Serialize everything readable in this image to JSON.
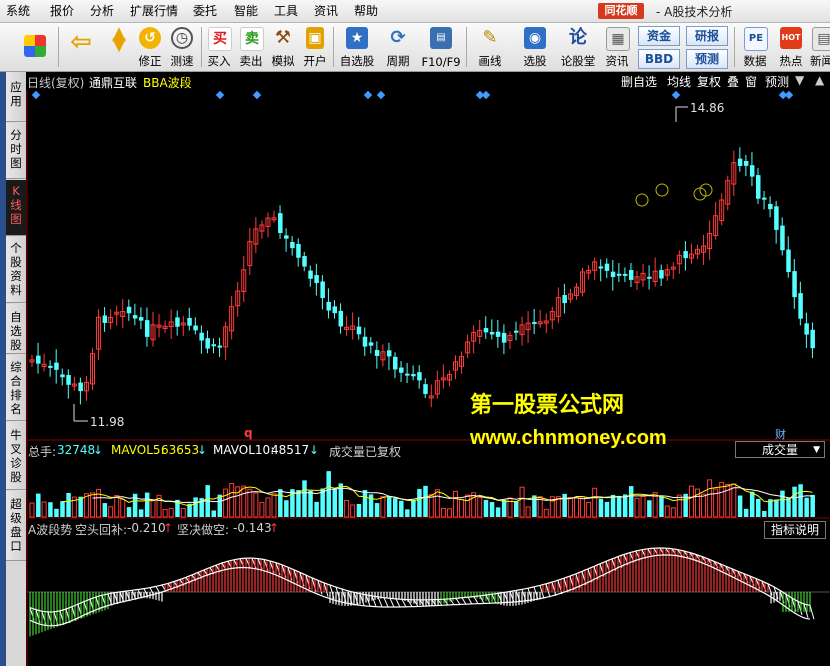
{
  "menubar": {
    "items": [
      "系统",
      "报价",
      "分析",
      "扩展行情",
      "委托",
      "智能",
      "工具",
      "资讯",
      "帮助"
    ],
    "brand": "同花顺",
    "title": "- A股技术分析"
  },
  "toolbar": {
    "buttons": [
      {
        "label": "",
        "icon": "grid-icon"
      },
      {
        "label": "",
        "icon": "back-arrow-icon"
      },
      {
        "label": "",
        "icon": "up-down-arrows-icon"
      },
      {
        "label": "修正",
        "icon": "correct-icon"
      },
      {
        "label": "测速",
        "icon": "clock-icon"
      },
      {
        "label": "买入",
        "icon": "buy-icon",
        "glyph": "买"
      },
      {
        "label": "卖出",
        "icon": "sell-icon",
        "glyph": "卖"
      },
      {
        "label": "模拟",
        "icon": "hammer-icon"
      },
      {
        "label": "开户",
        "icon": "lock-icon"
      },
      {
        "label": "自选股",
        "icon": "star-icon"
      },
      {
        "label": "周期",
        "icon": "cycle-icon"
      },
      {
        "label": "F10/F9",
        "icon": "f10-icon"
      },
      {
        "label": "画线",
        "icon": "pen-icon"
      },
      {
        "label": "选股",
        "icon": "select-stock-icon"
      },
      {
        "label": "论股堂",
        "icon": "lun-icon",
        "glyph": "论"
      },
      {
        "label": "资讯",
        "icon": "news-icon"
      },
      {
        "label": "数据",
        "icon": "pe-icon",
        "glyph": "PE"
      },
      {
        "label": "热点",
        "icon": "hot-icon",
        "glyph": "HOT"
      },
      {
        "label": "新闻",
        "icon": "news2-icon"
      }
    ],
    "funds": [
      "资金",
      "BBD"
    ],
    "research": [
      "研报",
      "预测"
    ]
  },
  "sidebar": {
    "tabs": [
      "应用",
      "分时图",
      "K线图",
      "个股资料",
      "自选股",
      "综合排名",
      "牛叉诊股",
      "超级盘口"
    ],
    "active": 2
  },
  "chart": {
    "period": "日线(复权)",
    "stock_name": "通鼎互联",
    "indicator": "BBA波段",
    "right_buttons": [
      "删自选",
      "均线",
      "复权",
      "叠",
      "窗",
      "预测"
    ],
    "price_high": "14.86",
    "price_low": "11.98",
    "marker_q": "q",
    "marker_cai": "财"
  },
  "volume_panel": {
    "total_label": "总手:",
    "total_value": "32748",
    "mavol5_label": "MAVOL5:",
    "mavol5_value": "63653",
    "mavol10_label": "MAVOL10:",
    "mavol10_value": "48517",
    "status": "成交量已复权",
    "dropdown": "成交量"
  },
  "indicator_panel": {
    "name": "A波段势",
    "label1": "空头回补:",
    "value1": "-0.210",
    "label2": "坚决做空:",
    "value2": "-0.143",
    "button": "指标说明"
  },
  "watermark": {
    "line1": "第一股票公式网",
    "line2": "www.chnmoney.com"
  },
  "colors": {
    "up": "#ff3a3a",
    "down": "#54ffff",
    "diamond": "#3f9bff",
    "yellow": "#ffff00",
    "green": "#3fd22e"
  }
}
